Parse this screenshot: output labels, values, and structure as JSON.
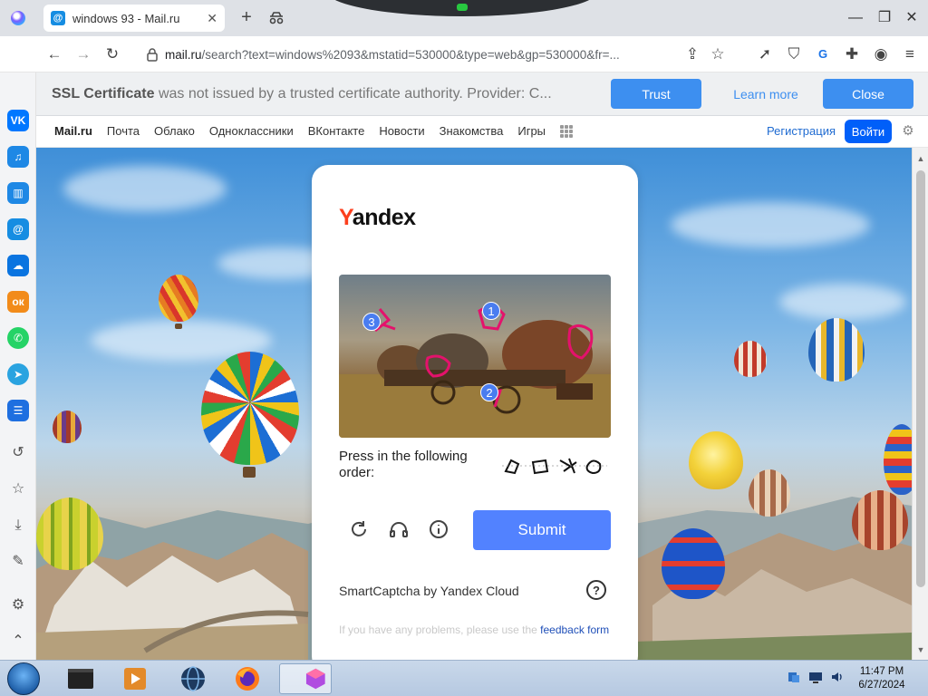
{
  "browser": {
    "tab_title": "windows 93 - Mail.ru",
    "tab_favicon_letter": "@",
    "url_host": "mail.ru",
    "url_rest": "/search?text=windows%2093&mstatid=530000&type=web&gp=530000&fr=..."
  },
  "ssl_bar": {
    "title": "SSL Certificate",
    "message": " was not issued by a trusted certificate authority. Provider: C...",
    "trust_label": "Trust",
    "learn_label": "Learn more",
    "close_label": "Close"
  },
  "sidebar": {
    "apps": [
      {
        "name": "vk",
        "glyph": "VK",
        "color": "#0077ff"
      },
      {
        "name": "music",
        "glyph": "♫",
        "color": "#1e88e5"
      },
      {
        "name": "stats",
        "glyph": "▥",
        "color": "#1e88e5"
      },
      {
        "name": "mail",
        "glyph": "@",
        "color": "#168de2"
      },
      {
        "name": "cloud",
        "glyph": "☁",
        "color": "#0a74e0"
      },
      {
        "name": "ok",
        "glyph": "ок",
        "color": "#f28b1a"
      },
      {
        "name": "whatsapp",
        "glyph": "✆",
        "color": "#25d366"
      },
      {
        "name": "telegram",
        "glyph": "➤",
        "color": "#2aa3e0"
      },
      {
        "name": "tasks",
        "glyph": "☰",
        "color": "#1e6fe0"
      }
    ]
  },
  "mail_header": {
    "brand": "Mail.ru",
    "links": [
      "Почта",
      "Облако",
      "Одноклассники",
      "ВКонтакте",
      "Новости",
      "Знакомства",
      "Игры"
    ],
    "register": "Регистрация",
    "login": "Войти"
  },
  "captcha": {
    "logo_first": "Y",
    "logo_rest": "andex",
    "badges": [
      "1",
      "2",
      "3"
    ],
    "instruction": "Press in the following order:",
    "submit": "Submit",
    "provider": "SmartCaptcha by Yandex Cloud",
    "help": "?",
    "problems_text": "If you have any problems, please use the ",
    "feedback_link": "feedback form"
  },
  "taskbar": {
    "time": "11:47 PM",
    "date": "6/27/2024"
  }
}
